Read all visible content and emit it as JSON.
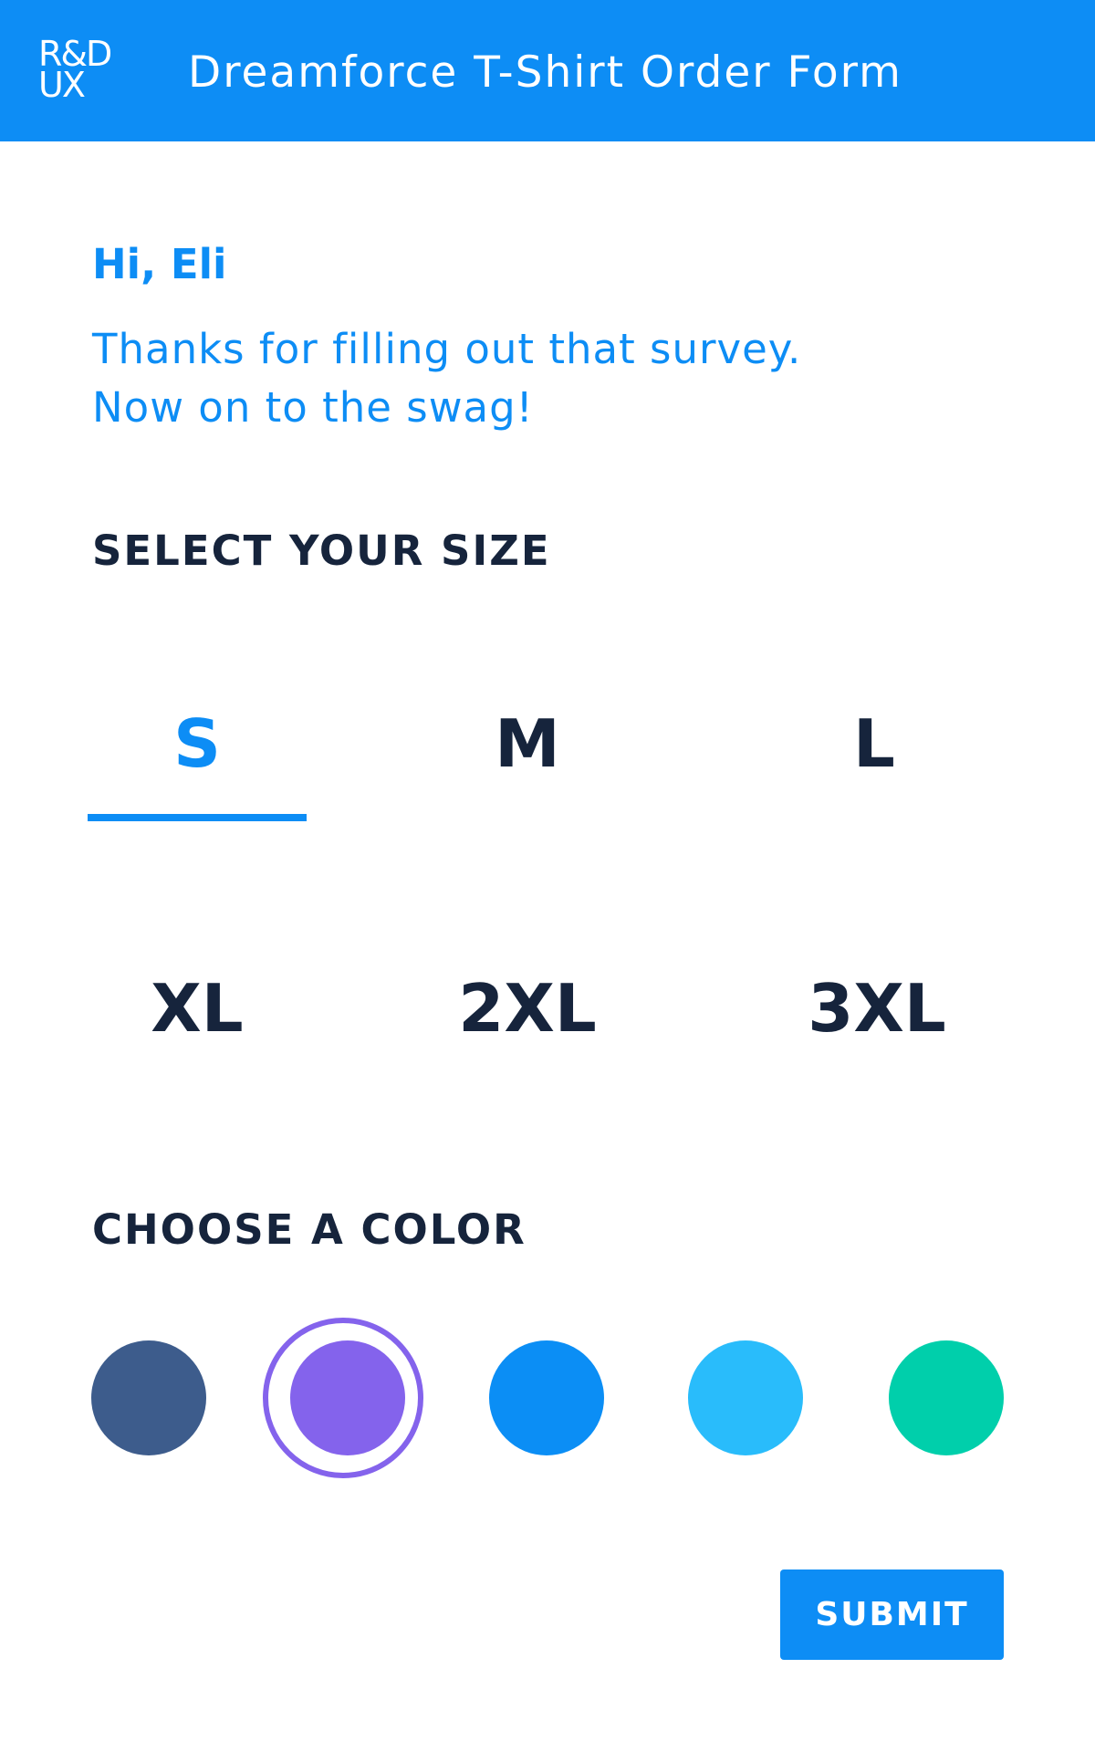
{
  "header": {
    "logo_line1": "R&D",
    "logo_line2": "UX",
    "title": "Dreamforce T-Shirt Order Form",
    "background_color": "#0d8df5"
  },
  "greeting": "Hi, Eli",
  "intro": {
    "line1": "Thanks for filling out that survey.",
    "line2": "Now on to the swag!"
  },
  "size_section": {
    "heading": "SELECT YOUR SIZE",
    "options": [
      "S",
      "M",
      "L",
      "XL",
      "2XL",
      "3XL"
    ],
    "selected": "S"
  },
  "color_section": {
    "heading": "CHOOSE A COLOR",
    "swatches": [
      "#3d5c8c",
      "#8463ec",
      "#0b8ef5",
      "#29bcfb",
      "#00cfab"
    ],
    "selected_index": 1
  },
  "submit_label": "SUBMIT",
  "accent_color": "#0d8df5",
  "text_color": "#16243c"
}
